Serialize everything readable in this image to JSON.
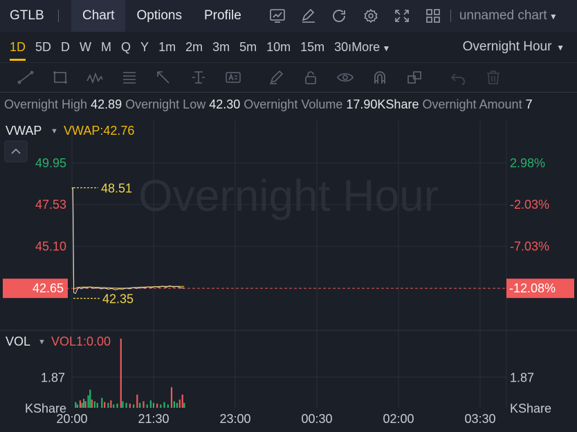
{
  "symbol": "GTLB",
  "nav_tabs": [
    {
      "label": "Chart",
      "active": true
    },
    {
      "label": "Options",
      "active": false
    },
    {
      "label": "Profile",
      "active": false
    }
  ],
  "toolbar_icons": [
    "chart-template-icon",
    "pen-icon",
    "refresh-icon",
    "settings-icon",
    "fullscreen-icon",
    "layout-grid-icon"
  ],
  "chart_name": "unnamed chart",
  "periods": [
    {
      "label": "1D",
      "active": true
    },
    {
      "label": "5D",
      "active": false
    },
    {
      "label": "D",
      "active": false
    },
    {
      "label": "W",
      "active": false
    },
    {
      "label": "M",
      "active": false
    },
    {
      "label": "Q",
      "active": false
    },
    {
      "label": "Y",
      "active": false
    },
    {
      "label": "1m",
      "active": false
    },
    {
      "label": "2m",
      "active": false
    },
    {
      "label": "3m",
      "active": false
    },
    {
      "label": "5m",
      "active": false
    },
    {
      "label": "10m",
      "active": false
    },
    {
      "label": "15m",
      "active": false
    },
    {
      "label": "30ı",
      "active": false
    },
    {
      "label": "More",
      "active": false
    }
  ],
  "session_select": "Overnight Hour",
  "draw_tools": [
    "trend-line-icon",
    "rectangle-icon",
    "wave-icon",
    "fib-icon",
    "arrow-icon",
    "vertical-line-icon",
    "text-icon",
    "brush-icon",
    "lock-icon",
    "eye-icon",
    "magnet-icon",
    "layers-icon",
    "undo-icon",
    "delete-icon"
  ],
  "info": {
    "high_label": "Overnight High",
    "high_value": "42.89",
    "low_label": "Overnight Low",
    "low_value": "42.30",
    "volume_label": "Overnight Volume",
    "volume_value": "17.90KShare",
    "amount_label": "Overnight Amount",
    "amount_value": "7"
  },
  "main_indicator": {
    "name": "VWAP",
    "value_text": "VWAP:42.76"
  },
  "watermark": "Overnight Hour",
  "vol_indicator": {
    "name": "VOL",
    "value_text": "VOL1:0.00"
  },
  "colors": {
    "up": "#26b36b",
    "down": "#f05a5a",
    "accent": "#f0b90b",
    "price_tag_bg": "#f05a5a"
  },
  "chart_data": {
    "type": "line",
    "x_ticks": [
      "20:00",
      "21:30",
      "23:00",
      "00:30",
      "02:00",
      "03:30"
    ],
    "price_axis": {
      "left_ticks": [
        {
          "label": "49.95",
          "value": 49.95,
          "dir": "up"
        },
        {
          "label": "47.53",
          "value": 47.53,
          "dir": "down"
        },
        {
          "label": "45.10",
          "value": 45.1,
          "dir": "down"
        }
      ],
      "right_ticks": [
        {
          "label": "2.98%",
          "value": 49.95,
          "dir": "up"
        },
        {
          "label": "-2.03%",
          "value": 47.53,
          "dir": "down"
        },
        {
          "label": "-7.03%",
          "value": 45.1,
          "dir": "down"
        }
      ],
      "current_price": {
        "label": "42.65",
        "value": 42.65
      },
      "current_change": {
        "label": "-12.08%",
        "value": 42.65
      },
      "ylim": [
        40.2,
        52.4
      ]
    },
    "annotations": [
      {
        "label": "48.51",
        "value": 48.51
      },
      {
        "label": "42.35",
        "value": 42.35
      }
    ],
    "time_range": [
      0,
      480
    ],
    "price_series": [
      [
        0,
        48.51
      ],
      [
        1,
        48.51
      ],
      [
        2,
        42.4
      ],
      [
        4,
        42.35
      ],
      [
        6,
        42.6
      ],
      [
        8,
        42.7
      ],
      [
        10,
        42.62
      ],
      [
        13,
        42.7
      ],
      [
        16,
        42.66
      ],
      [
        20,
        42.74
      ],
      [
        24,
        42.64
      ],
      [
        28,
        42.7
      ],
      [
        32,
        42.62
      ],
      [
        36,
        42.66
      ],
      [
        40,
        42.6
      ],
      [
        44,
        42.64
      ],
      [
        48,
        42.56
      ],
      [
        52,
        42.62
      ],
      [
        56,
        42.6
      ],
      [
        60,
        42.66
      ],
      [
        64,
        42.62
      ],
      [
        68,
        42.7
      ],
      [
        72,
        42.64
      ],
      [
        76,
        42.72
      ],
      [
        80,
        42.66
      ],
      [
        84,
        42.74
      ],
      [
        88,
        42.68
      ],
      [
        92,
        42.76
      ],
      [
        96,
        42.7
      ],
      [
        100,
        42.78
      ],
      [
        104,
        42.7
      ],
      [
        108,
        42.8
      ],
      [
        112,
        42.72
      ],
      [
        116,
        42.76
      ],
      [
        120,
        42.68
      ],
      [
        124,
        42.66
      ]
    ],
    "vwap_series": [
      [
        0,
        48.51
      ],
      [
        1,
        48.4
      ],
      [
        2,
        42.6
      ],
      [
        6,
        42.7
      ],
      [
        12,
        42.72
      ],
      [
        20,
        42.72
      ],
      [
        30,
        42.7
      ],
      [
        40,
        42.68
      ],
      [
        50,
        42.66
      ],
      [
        60,
        42.66
      ],
      [
        70,
        42.7
      ],
      [
        80,
        42.72
      ],
      [
        90,
        42.74
      ],
      [
        100,
        42.76
      ],
      [
        110,
        42.76
      ],
      [
        124,
        42.76
      ]
    ],
    "volume_axis": {
      "label": "1.87",
      "value": 1.87,
      "unit": "KShare",
      "ylim": [
        0,
        4.7
      ]
    },
    "volume_bars": [
      {
        "t": 4,
        "v": 0.35,
        "dir": "up"
      },
      {
        "t": 6,
        "v": 0.2,
        "dir": "up"
      },
      {
        "t": 9,
        "v": 0.45,
        "dir": "down"
      },
      {
        "t": 11,
        "v": 0.3,
        "dir": "up"
      },
      {
        "t": 13,
        "v": 0.55,
        "dir": "up"
      },
      {
        "t": 15,
        "v": 0.4,
        "dir": "down"
      },
      {
        "t": 18,
        "v": 0.75,
        "dir": "up"
      },
      {
        "t": 20,
        "v": 1.1,
        "dir": "up"
      },
      {
        "t": 22,
        "v": 0.5,
        "dir": "down"
      },
      {
        "t": 25,
        "v": 0.4,
        "dir": "up"
      },
      {
        "t": 28,
        "v": 0.3,
        "dir": "up"
      },
      {
        "t": 33,
        "v": 0.6,
        "dir": "up"
      },
      {
        "t": 36,
        "v": 0.35,
        "dir": "down"
      },
      {
        "t": 40,
        "v": 0.3,
        "dir": "up"
      },
      {
        "t": 43,
        "v": 0.45,
        "dir": "down"
      },
      {
        "t": 46,
        "v": 0.2,
        "dir": "up"
      },
      {
        "t": 50,
        "v": 0.25,
        "dir": "up"
      },
      {
        "t": 54,
        "v": 4.2,
        "dir": "down"
      },
      {
        "t": 56,
        "v": 0.4,
        "dir": "up"
      },
      {
        "t": 60,
        "v": 0.3,
        "dir": "up"
      },
      {
        "t": 64,
        "v": 0.25,
        "dir": "down"
      },
      {
        "t": 68,
        "v": 0.2,
        "dir": "up"
      },
      {
        "t": 72,
        "v": 0.8,
        "dir": "down"
      },
      {
        "t": 75,
        "v": 0.3,
        "dir": "up"
      },
      {
        "t": 79,
        "v": 0.4,
        "dir": "down"
      },
      {
        "t": 83,
        "v": 0.2,
        "dir": "up"
      },
      {
        "t": 87,
        "v": 0.45,
        "dir": "up"
      },
      {
        "t": 90,
        "v": 0.3,
        "dir": "up"
      },
      {
        "t": 94,
        "v": 0.25,
        "dir": "down"
      },
      {
        "t": 98,
        "v": 0.2,
        "dir": "up"
      },
      {
        "t": 102,
        "v": 0.35,
        "dir": "up"
      },
      {
        "t": 106,
        "v": 0.2,
        "dir": "up"
      },
      {
        "t": 110,
        "v": 1.25,
        "dir": "down"
      },
      {
        "t": 113,
        "v": 0.4,
        "dir": "up"
      },
      {
        "t": 116,
        "v": 0.3,
        "dir": "up"
      },
      {
        "t": 119,
        "v": 0.5,
        "dir": "down"
      },
      {
        "t": 122,
        "v": 0.8,
        "dir": "down"
      },
      {
        "t": 124,
        "v": 0.3,
        "dir": "up"
      }
    ]
  }
}
